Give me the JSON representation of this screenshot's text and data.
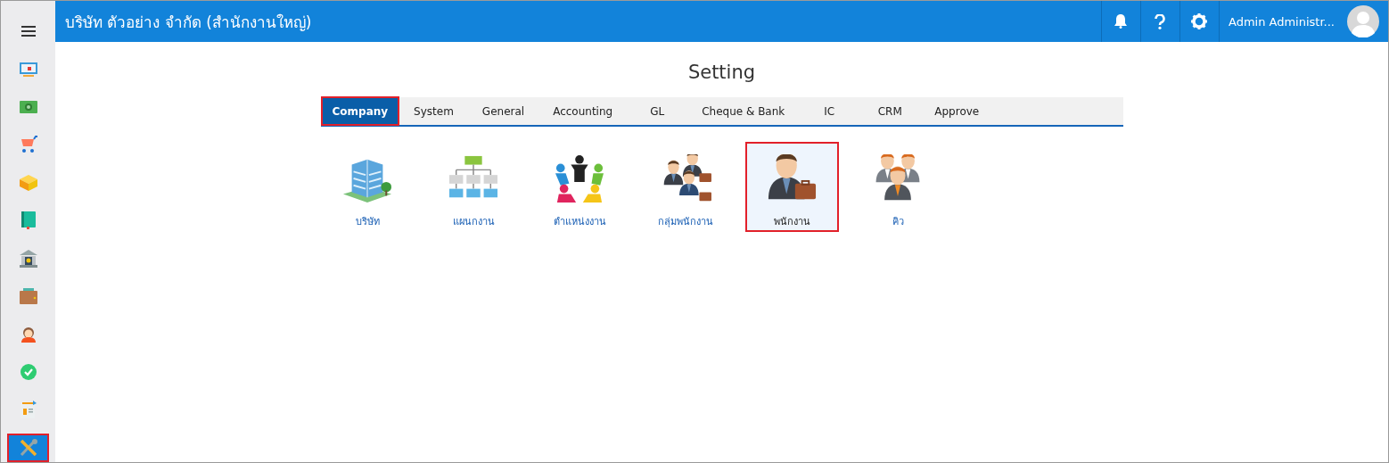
{
  "sidebar": {
    "items": [
      {
        "kind": "menu",
        "selected": false
      },
      {
        "kind": "monitor",
        "selected": false
      },
      {
        "kind": "money",
        "selected": false
      },
      {
        "kind": "cart",
        "selected": false
      },
      {
        "kind": "box",
        "selected": false
      },
      {
        "kind": "book",
        "selected": false
      },
      {
        "kind": "bank",
        "selected": false
      },
      {
        "kind": "wallet",
        "selected": false
      },
      {
        "kind": "person",
        "selected": false
      },
      {
        "kind": "check",
        "selected": false
      },
      {
        "kind": "invoice",
        "selected": false
      },
      {
        "kind": "tools",
        "selected": true
      }
    ]
  },
  "header": {
    "title": "บริษัท ตัวอย่าง จำกัด (สำนักงานใหญ่)",
    "user": "Admin Administr..."
  },
  "page": {
    "title": "Setting"
  },
  "tabs": [
    {
      "label": "Company",
      "selected": true
    },
    {
      "label": "System",
      "selected": false
    },
    {
      "label": "General",
      "selected": false
    },
    {
      "label": "Accounting",
      "selected": false
    },
    {
      "label": "GL",
      "selected": false
    },
    {
      "label": "Cheque & Bank",
      "selected": false
    },
    {
      "label": "IC",
      "selected": false
    },
    {
      "label": "CRM",
      "selected": false
    },
    {
      "label": "Approve",
      "selected": false
    }
  ],
  "tiles": [
    {
      "label": "บริษัท",
      "kind": "building",
      "selected": false
    },
    {
      "label": "แผนกงาน",
      "kind": "orgchart",
      "selected": false
    },
    {
      "label": "ตำแหน่งงาน",
      "kind": "people-circle",
      "selected": false
    },
    {
      "label": "กลุ่มพนักงาน",
      "kind": "group",
      "selected": false
    },
    {
      "label": "พนักงาน",
      "kind": "employee",
      "selected": true
    },
    {
      "label": "คิว",
      "kind": "team",
      "selected": false
    }
  ]
}
